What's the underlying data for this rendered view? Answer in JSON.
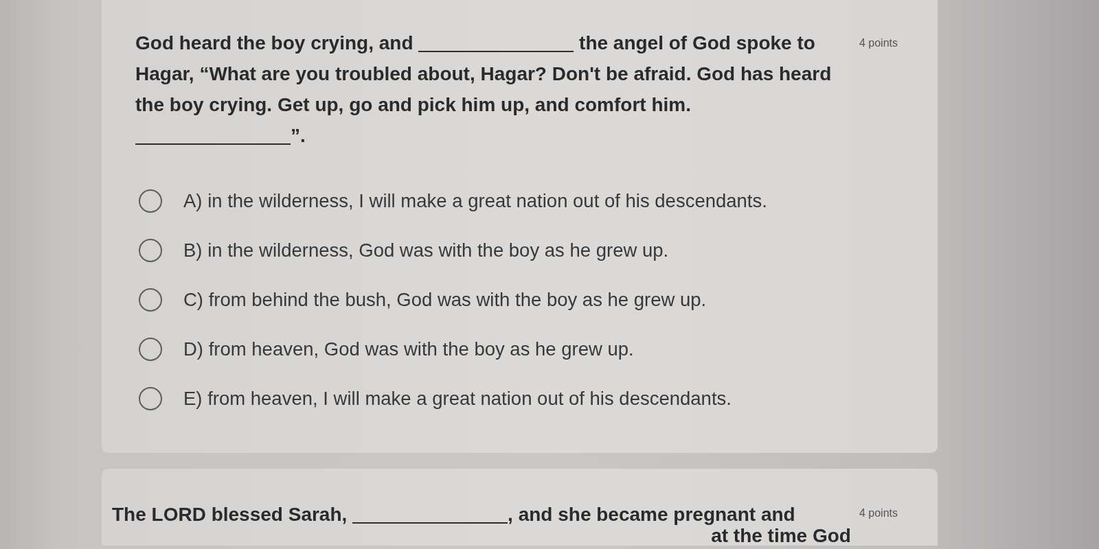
{
  "questions": [
    {
      "lines": [
        {
          "clipped": false,
          "segments": [
            {
              "kind": "text",
              "text": "God heard the boy crying, and "
            },
            {
              "kind": "blank"
            },
            {
              "kind": "text",
              "text": " the angel of God spoke to"
            }
          ]
        },
        {
          "clipped": false,
          "segments": [
            {
              "kind": "text",
              "text": "Hagar, “What are you troubled about, Hagar? Don't be afraid. God has heard"
            }
          ]
        },
        {
          "clipped": false,
          "segments": [
            {
              "kind": "text",
              "text": "the boy crying. Get up, go and pick him up, and comfort him."
            }
          ]
        },
        {
          "clipped": false,
          "segments": [
            {
              "kind": "blank"
            },
            {
              "kind": "text",
              "text": "”."
            }
          ]
        }
      ],
      "points": "4 points",
      "options": [
        {
          "label": "A) in the wilderness, I will make a great nation out of his descendants.",
          "selected": false
        },
        {
          "label": "B) in the wilderness, God was with the boy as he grew up.",
          "selected": false
        },
        {
          "label": "C) from behind the bush, God was with the boy as he grew up.",
          "selected": false
        },
        {
          "label": "D) from heaven, God was with the boy as he grew up.",
          "selected": false
        },
        {
          "label": "E) from heaven, I will make a great nation out of his descendants.",
          "selected": false
        }
      ]
    },
    {
      "lines": [
        {
          "clipped": false,
          "segments": [
            {
              "kind": "text",
              "text": "The LORD blessed Sarah, "
            },
            {
              "kind": "blank"
            },
            {
              "kind": "text",
              "text": ", and she became pregnant and"
            }
          ]
        },
        {
          "clipped": true,
          "segments": [
            {
              "kind": "text",
              "text": "at the time God"
            }
          ]
        }
      ],
      "points": "4 points"
    }
  ]
}
